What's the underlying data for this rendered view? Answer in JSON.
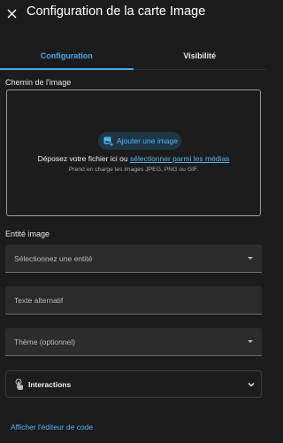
{
  "dialog": {
    "title": "Configuration de la carte Image"
  },
  "tabs": [
    {
      "label": "Configuration",
      "active": true
    },
    {
      "label": "Visibilité",
      "active": false
    }
  ],
  "image_path": {
    "label": "Chemin de l'image",
    "add_button_label": "Ajouter une image",
    "drop_text_before": "Déposez votre fichier ici ou ",
    "drop_link_label": "sélectionner parmi les médias",
    "hint": "Prend en charge les images JPEG, PNG ou GIF."
  },
  "entity": {
    "section_label": "Entité image",
    "placeholder": "Sélectionnez une entité"
  },
  "alt_text": {
    "placeholder": "Texte alternatif"
  },
  "theme": {
    "placeholder": "Thème (optionnel)"
  },
  "interactions": {
    "label": "Interactions"
  },
  "footer": {
    "code_editor_link": "Afficher l'éditeur de code"
  },
  "colors": {
    "background": "#1c1c1c",
    "accent": "#4aa8e8",
    "field_background": "#2c2c2c"
  },
  "icons": {
    "close": "close-icon",
    "add_image": "image-plus-icon",
    "entity_dropdown": "caret-down-icon",
    "theme_dropdown": "caret-down-icon",
    "interactions": "gesture-tap-icon",
    "interactions_expand": "chevron-down-icon"
  }
}
